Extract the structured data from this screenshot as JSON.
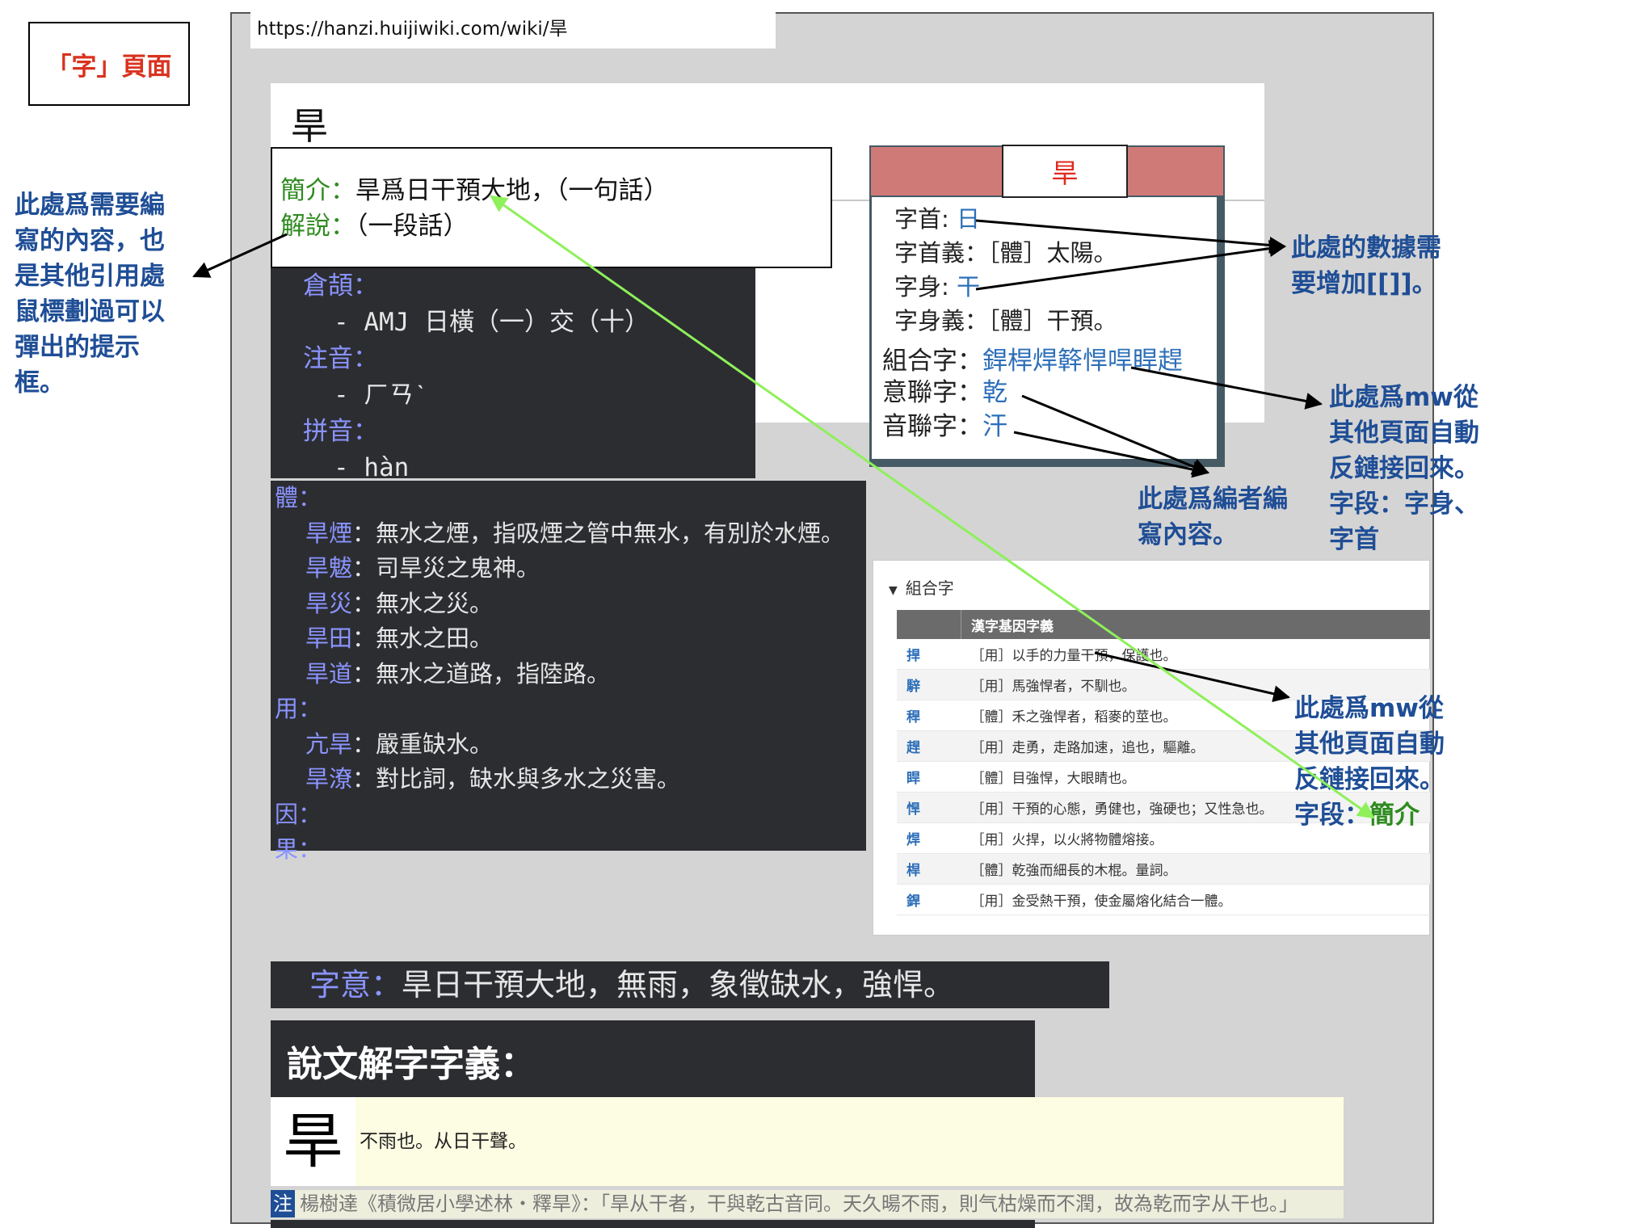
{
  "page_label": "「字」頁面",
  "annotations": {
    "left": [
      "此處爲需要編",
      "寫的內容，也",
      "是其他引用處",
      "鼠標劃過可以",
      "彈出的提示",
      "框。"
    ],
    "data_needs": [
      "此處的數據需",
      "要增加[[]]。"
    ],
    "mw_backlink_radical": [
      "此處爲mw從",
      "其他頁面自動",
      "反鏈接回來。",
      "字段：字身、",
      "字首"
    ],
    "editor_content": [
      "此處爲編者編",
      "寫內容。"
    ],
    "mw_backlink_intro_prefix": [
      "此處爲mw從",
      "其他頁面自動",
      "反鏈接回來。"
    ],
    "mw_backlink_intro_last": "字段：",
    "mw_backlink_intro_field": "簡介"
  },
  "browser": {
    "url": "https://hanzi.huijiwiki.com/wiki/旱"
  },
  "article": {
    "title": "旱"
  },
  "tooltip": {
    "intro_label": "簡介：",
    "intro_text": "旱爲日干預大地，（一句話）",
    "explain_label": "解說：",
    "explain_text": "（一段話）"
  },
  "info": {
    "cangjie_label": "倉頡：",
    "cangjie_value": "- AMJ 日橫（一）交（十）",
    "zhuyin_label": "注音：",
    "zhuyin_value": "- ㄏㄢˋ",
    "pinyin_label": "拼音：",
    "pinyin_value": "- hàn"
  },
  "usage": {
    "ti_label": "體：",
    "ti_items": [
      {
        "word": "旱煙",
        "def": "：無水之煙，指吸煙之管中無水，有別於水煙。"
      },
      {
        "word": "旱魃",
        "def": "：司旱災之鬼神。"
      },
      {
        "word": "旱災",
        "def": "：無水之災。"
      },
      {
        "word": "旱田",
        "def": "：無水之田。"
      },
      {
        "word": "旱道",
        "def": "：無水之道路，指陸路。"
      }
    ],
    "yong_label": "用：",
    "yong_items": [
      {
        "word": "亢旱",
        "def": "：嚴重缺水。"
      },
      {
        "word": "旱潦",
        "def": "：對比詞，缺水與多水之災害。"
      }
    ],
    "yin_label": "因：",
    "guo_label": "果："
  },
  "char_box": {
    "header": "旱",
    "radical_label": "字首: ",
    "radical": "日",
    "radical_meaning": "字首義：［體］太陽。",
    "body_label": "字身: ",
    "body": "干",
    "body_meaning": "字身義：［體］干預。",
    "compound_label": "組合字：",
    "compound": "銲桿焊簳悍哻睅趕",
    "yilian_label": "意聯字：",
    "yilian": "乾",
    "yinlian_label": "音聯字：",
    "yinlian": "汗"
  },
  "combo_table": {
    "toggle": "組合字",
    "header_char": "",
    "header_meaning": "漢字基因字義",
    "rows": [
      {
        "char": "捍",
        "meaning": "［用］以手的力量干預，保護也。"
      },
      {
        "char": "騂",
        "meaning": "［用］馬強悍者，不馴也。"
      },
      {
        "char": "稈",
        "meaning": "［體］禾之強悍者，稻麥的莖也。"
      },
      {
        "char": "趕",
        "meaning": "［用］走勇，走路加速，追也，驅離。"
      },
      {
        "char": "睅",
        "meaning": "［體］目強悍，大眼睛也。"
      },
      {
        "char": "悍",
        "meaning": "［用］干預的心態，勇健也，強硬也；又性急也。"
      },
      {
        "char": "焊",
        "meaning": "［用］火捍，以火將物體熔接。"
      },
      {
        "char": "桿",
        "meaning": "［體］乾強而細長的木棍。量詞。"
      },
      {
        "char": "銲",
        "meaning": "［用］金受熱干預，使金屬熔化結合一體。"
      }
    ]
  },
  "meaning": {
    "label": "字意：",
    "text": "旱日干預大地，無雨，象徵缺水，強悍。"
  },
  "shuowen": {
    "heading": "說文解字字義：",
    "glyph": "旱",
    "text": "不雨也。从日干聲。",
    "note_tag": "注",
    "note_text": "楊樹達《積微居小學述林・釋旱》：「旱从干者，干與乾古音同。天久暘不雨，則气枯燥而不潤，故為乾而字从干也。」"
  },
  "colors": {
    "annotation": "#1f4e96",
    "label_red": "#d9321f",
    "arrow_green": "#8ef05a",
    "dark_bg": "#2c2d31",
    "info_key": "#8a94ff",
    "link": "#2d6fb8"
  }
}
